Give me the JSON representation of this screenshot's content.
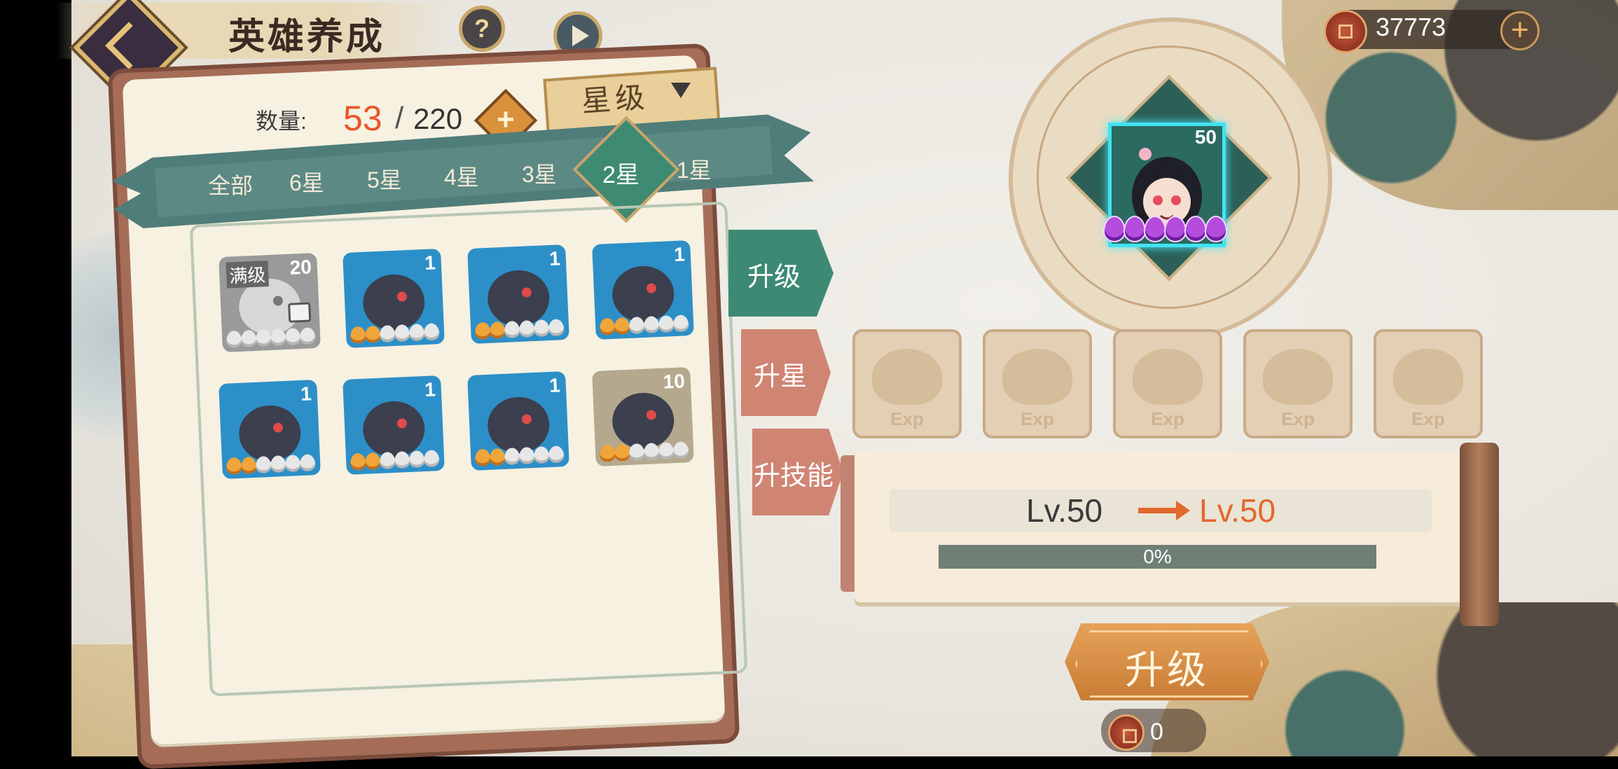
{
  "header": {
    "title": "英雄养成",
    "help_label": "?"
  },
  "currency": {
    "amount": "37773",
    "plus_label": "+"
  },
  "inventory": {
    "count_label": "数量:",
    "current": "53",
    "separator": "/",
    "max": "220",
    "add_label": "+"
  },
  "sort": {
    "label": "星级"
  },
  "star_filters": [
    {
      "label": "全部"
    },
    {
      "label": "6星"
    },
    {
      "label": "5星"
    },
    {
      "label": "4星"
    },
    {
      "label": "3星"
    },
    {
      "label": "2星",
      "active": true
    },
    {
      "label": "1星"
    }
  ],
  "heroes": [
    {
      "level": "20",
      "badge": "满级",
      "stars_on": 0,
      "stars_total": 6,
      "color": "#9a9a9a",
      "locked": true
    },
    {
      "level": "1",
      "stars_on": 2,
      "stars_total": 6,
      "color": "#2d8fc8"
    },
    {
      "level": "1",
      "stars_on": 2,
      "stars_total": 6,
      "color": "#2d8fc8"
    },
    {
      "level": "1",
      "stars_on": 2,
      "stars_total": 6,
      "color": "#2d8fc8"
    },
    {
      "level": "1",
      "stars_on": 2,
      "stars_total": 6,
      "color": "#2d8fc8"
    },
    {
      "level": "1",
      "stars_on": 2,
      "stars_total": 6,
      "color": "#2d8fc8"
    },
    {
      "level": "1",
      "stars_on": 2,
      "stars_total": 6,
      "color": "#2d8fc8"
    },
    {
      "level": "10",
      "stars_on": 2,
      "stars_total": 6,
      "color": "#b4a98e"
    }
  ],
  "side_tabs": [
    {
      "label": "升级",
      "active": true,
      "color": "#3d8a74"
    },
    {
      "label": "升星",
      "active": false,
      "color": "#d08573"
    },
    {
      "label": "升技能",
      "active": false,
      "color": "#d08573"
    }
  ],
  "selected_hero": {
    "level": "50",
    "purple_stars": 6
  },
  "exp_slots": [
    "Exp",
    "Exp",
    "Exp",
    "Exp",
    "Exp"
  ],
  "level_panel": {
    "from": "Lv.50",
    "to": "Lv.50",
    "progress_text": "0%",
    "progress_value": 0
  },
  "upgrade": {
    "label": "升级",
    "cost": "0"
  }
}
